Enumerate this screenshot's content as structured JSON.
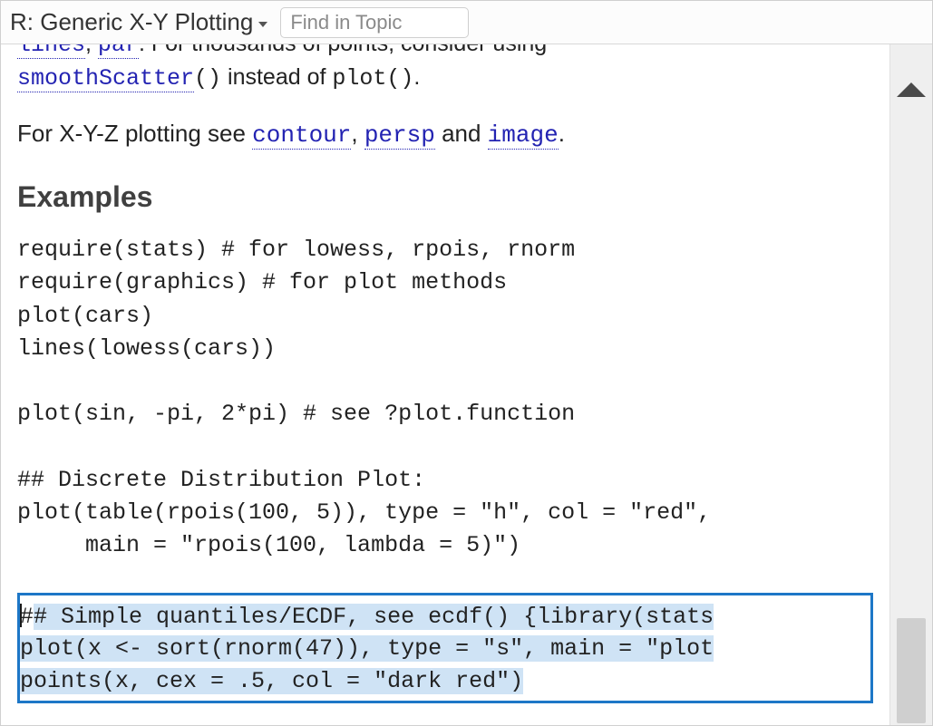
{
  "header": {
    "title": "R: Generic X-Y Plotting",
    "search_placeholder": "Find in Topic"
  },
  "cutoff": {
    "link_lines": "lines",
    "link_par": "par",
    "fragment_after_par": ". For thousands of points, consider using ",
    "link_smooth": "smoothScatter",
    "after_smooth_code": "()",
    "middle_text": " instead of ",
    "plot_code": "plot()",
    "period": "."
  },
  "xyz": {
    "prefix": "For X-Y-Z plotting see ",
    "link_contour": "contour",
    "sep1": ", ",
    "link_persp": "persp",
    "sep2": " and ",
    "link_image": "image",
    "suffix": "."
  },
  "section_heading": "Examples",
  "code_block": "require(stats) # for lowess, rpois, rnorm\nrequire(graphics) # for plot methods\nplot(cars)\nlines(lowess(cars))\n\nplot(sin, -pi, 2*pi) # see ?plot.function\n\n## Discrete Distribution Plot:\nplot(table(rpois(100, 5)), type = \"h\", col = \"red\",\n     main = \"rpois(100, lambda = 5)\")",
  "selection": {
    "line1_hash": "#",
    "line1_rest": "# Simple quantiles/ECDF, see ecdf() {library(stats",
    "line2": "plot(x <- sort(rnorm(47)), type = \"s\", main = \"plot",
    "line3": "points(x, cex = .5, col = \"dark red\")"
  }
}
